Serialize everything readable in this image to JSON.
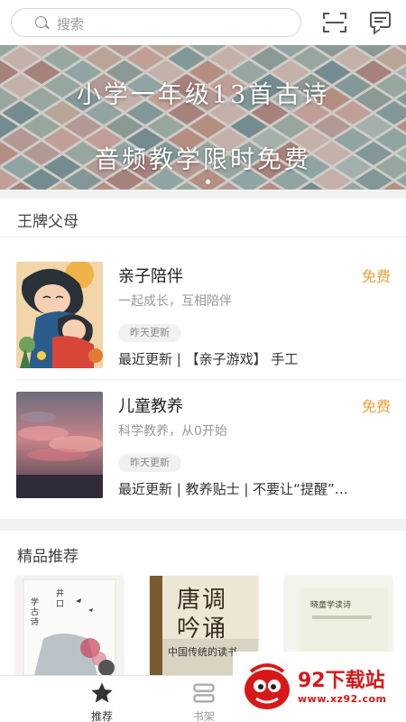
{
  "search": {
    "placeholder": "搜索"
  },
  "banner": {
    "line1": "小学一年级13首古诗",
    "line2": "音频教学限时免费"
  },
  "sections": {
    "parents": {
      "title": "王牌父母",
      "items": [
        {
          "title": "亲子陪伴",
          "price": "免费",
          "subtitle": "一起成长，互相陪伴",
          "tag": "昨天更新",
          "latest": "最近更新 | 【亲子游戏】 手工"
        },
        {
          "title": "儿童教养",
          "price": "免费",
          "subtitle": "科学教养，从0开始",
          "tag": "昨天更新",
          "latest": "最近更新 | 教养贴士 | 不要让“提醒”…"
        }
      ]
    },
    "recommend": {
      "title": "精品推荐",
      "books": [
        {
          "cover_text": [
            "井",
            "口",
            "学",
            "古",
            "诗"
          ]
        },
        {
          "cover_text": [
            "唐调",
            "吟诵",
            "中国传统的读书"
          ]
        },
        {
          "cover_text": [
            "晓童学读诗"
          ]
        }
      ]
    }
  },
  "tabbar": {
    "tabs": [
      {
        "label": "推荐",
        "icon": "star-icon",
        "active": true
      },
      {
        "label": "书架",
        "icon": "bookshelf-icon",
        "active": false
      }
    ]
  },
  "watermark": {
    "name": "92下载站",
    "url": "www.xz92.com"
  },
  "colors": {
    "accent_price": "#e8a23a",
    "watermark_red": "#d81818"
  }
}
